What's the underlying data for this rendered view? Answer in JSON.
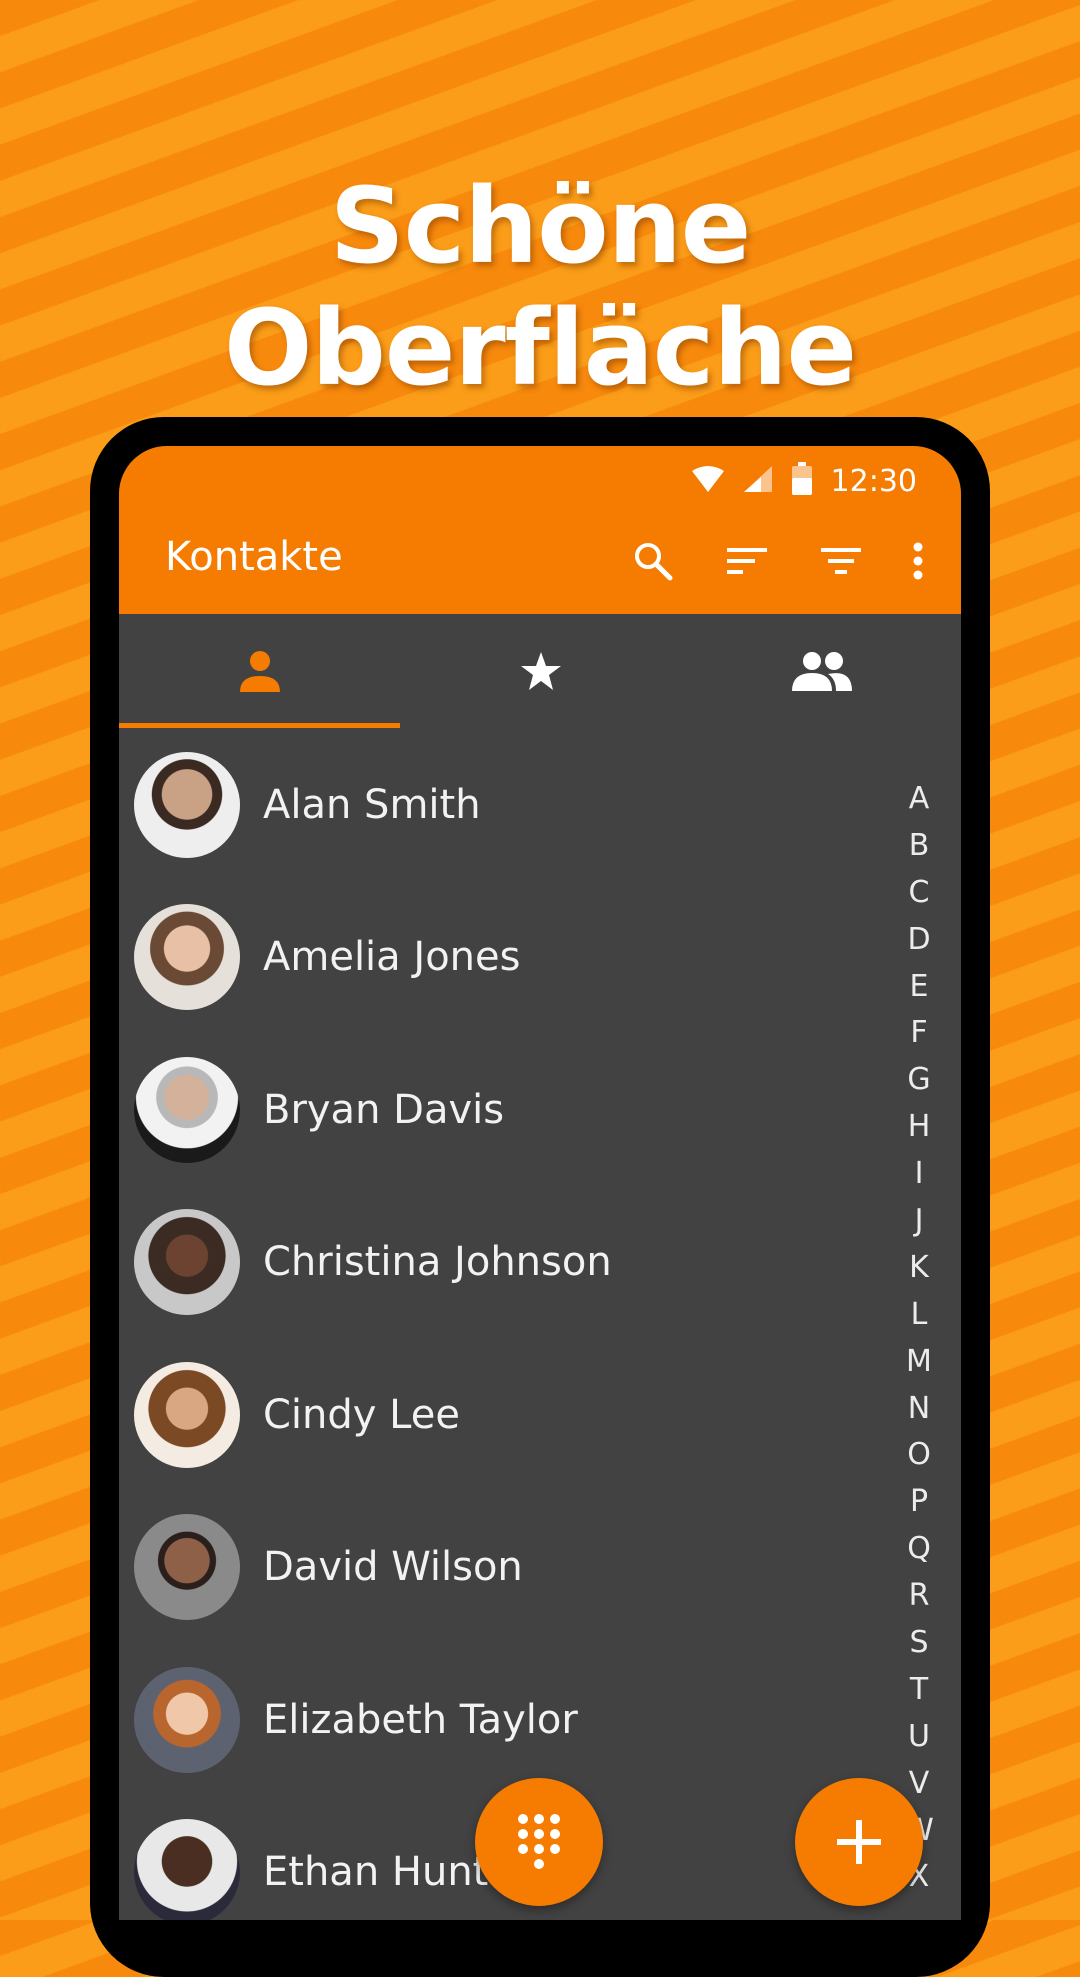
{
  "headline": "Schöne Oberfläche",
  "status_bar": {
    "time": "12:30",
    "icons": [
      "wifi-icon",
      "signal-icon",
      "battery-icon"
    ]
  },
  "app_bar": {
    "title": "Kontakte",
    "actions": [
      "search-icon",
      "sort-icon",
      "filter-icon",
      "more-vert-icon"
    ]
  },
  "tabs": [
    {
      "icon": "person-icon",
      "selected": true
    },
    {
      "icon": "star-icon",
      "selected": false
    },
    {
      "icon": "group-icon",
      "selected": false
    }
  ],
  "contacts": [
    {
      "name": "Alan Smith"
    },
    {
      "name": "Amelia Jones"
    },
    {
      "name": "Bryan Davis"
    },
    {
      "name": "Christina Johnson"
    },
    {
      "name": "Cindy Lee"
    },
    {
      "name": "David Wilson"
    },
    {
      "name": "Elizabeth Taylor"
    },
    {
      "name": "Ethan Hunt"
    }
  ],
  "alphabet": [
    "A",
    "B",
    "C",
    "D",
    "E",
    "F",
    "G",
    "H",
    "I",
    "J",
    "K",
    "L",
    "M",
    "N",
    "O",
    "P",
    "Q",
    "R",
    "S",
    "T",
    "U",
    "V",
    "W",
    "X"
  ],
  "fabs": [
    "dialpad-icon",
    "add-icon"
  ],
  "colors": {
    "accent": "#f57c00",
    "background": "#424242",
    "text": "#f2f2f2"
  }
}
